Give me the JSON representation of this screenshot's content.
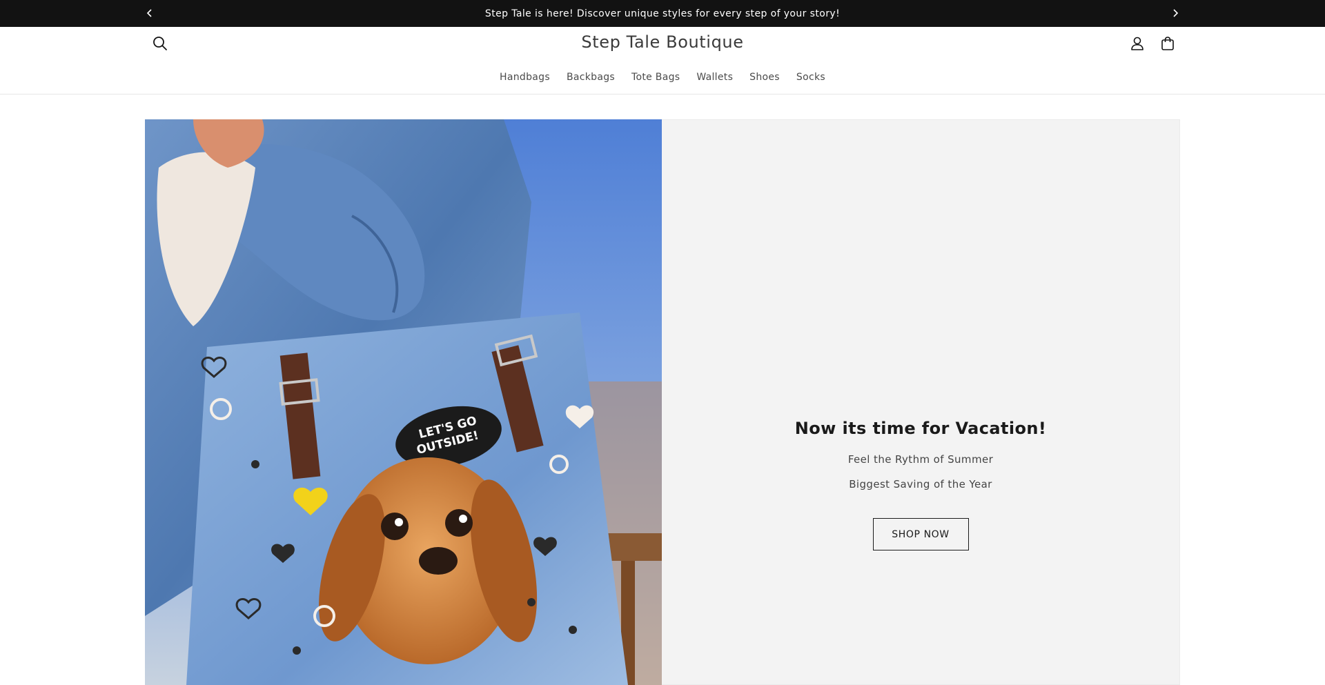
{
  "announcement": {
    "text": "Step Tale is here! Discover unique styles for every step of your story!",
    "prev_icon": "chevron-left-icon",
    "next_icon": "chevron-right-icon"
  },
  "header": {
    "store_name": "Step Tale Boutique",
    "search_icon": "search-icon",
    "account_icon": "user-icon",
    "cart_icon": "shopping-bag-icon",
    "nav": [
      {
        "label": "Handbags"
      },
      {
        "label": "Backbags"
      },
      {
        "label": "Tote Bags"
      },
      {
        "label": "Wallets"
      },
      {
        "label": "Shoes"
      },
      {
        "label": "Socks"
      }
    ]
  },
  "hero": {
    "image_alt": "Blue tote bag with cartoon puppy illustration",
    "bag_patch_text_line1": "LET'S GO",
    "bag_patch_text_line2": "OUTSIDE!",
    "heading": "Now its time for Vacation!",
    "line1": "Feel the Rythm of Summer",
    "line2": "Biggest Saving of the Year",
    "button_label": "SHOP NOW"
  },
  "colors": {
    "announcement_bg": "#121212",
    "panel_bg": "#f3f3f3",
    "text": "#121212"
  }
}
